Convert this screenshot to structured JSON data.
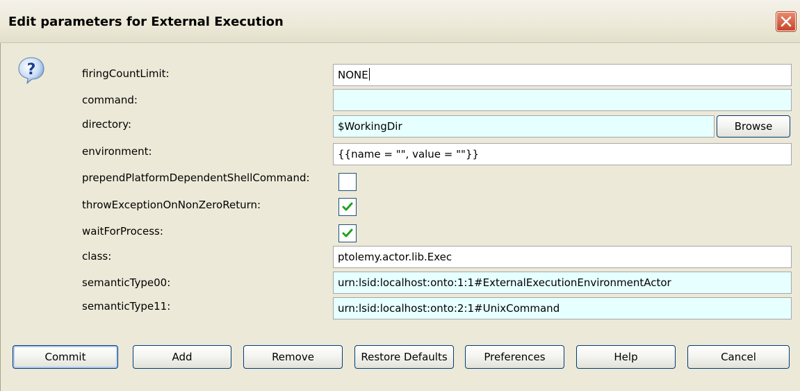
{
  "window": {
    "title": "Edit parameters for External Execution",
    "close_icon": "close-x-icon"
  },
  "help_icon": "question-mark-icon",
  "params": [
    {
      "label": "firingCountLimit:",
      "value": "NONE"
    },
    {
      "label": "command:",
      "value": ""
    },
    {
      "label": "directory:",
      "value": "$WorkingDir"
    },
    {
      "label": "environment:",
      "value": "{{name = \"\", value = \"\"}}"
    },
    {
      "label": "prependPlatformDependentShellCommand:",
      "checked": false
    },
    {
      "label": "throwExceptionOnNonZeroReturn:",
      "checked": true
    },
    {
      "label": "waitForProcess:",
      "checked": true
    },
    {
      "label": "class:",
      "value": "ptolemy.actor.lib.Exec"
    },
    {
      "label": "semanticType00:",
      "value": "urn:lsid:localhost:onto:1:1#ExternalExecutionEnvironmentActor"
    },
    {
      "label": "semanticType11:",
      "value": "urn:lsid:localhost:onto:2:1#UnixCommand"
    }
  ],
  "browse_label": "Browse",
  "buttons": {
    "commit": "Commit",
    "add": "Add",
    "remove": "Remove",
    "restore_defaults": "Restore Defaults",
    "preferences": "Preferences",
    "help": "Help",
    "cancel": "Cancel"
  },
  "colors": {
    "dialog_bg": "#ece9d8",
    "field_editable": "#ffffff",
    "field_expression": "#e6ffff",
    "checkbox_check": "#21a121",
    "button_border": "#003c74",
    "close_button": "#c8442a"
  }
}
